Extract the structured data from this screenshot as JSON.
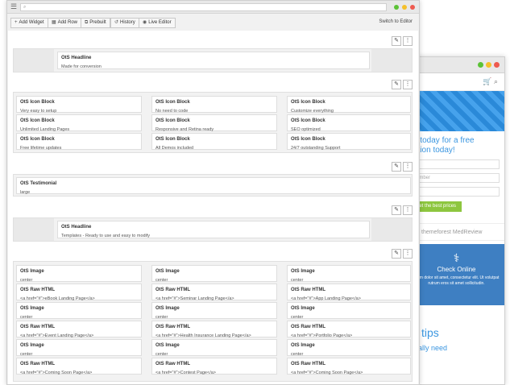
{
  "toolbar": {
    "add_widget": "Add Widget",
    "add_row": "Add Row",
    "prebuilt": "Prebuilt",
    "history": "History",
    "live_editor": "Live Editor",
    "switch": "Switch to Editor"
  },
  "rows": {
    "r1": {
      "title": "OtS Headline",
      "desc": "Made for conversion"
    },
    "r2": {
      "col1": [
        {
          "title": "OtS Icon Block",
          "desc": "Very easy to setup"
        },
        {
          "title": "OtS Icon Block",
          "desc": "Unlimited Landing Pages"
        },
        {
          "title": "OtS Icon Block",
          "desc": "Free lifetime updates"
        }
      ],
      "col2": [
        {
          "title": "OtS Icon Block",
          "desc": "No need to code"
        },
        {
          "title": "OtS Icon Block",
          "desc": "Responsive and Retina ready"
        },
        {
          "title": "OtS Icon Block",
          "desc": "All Demos included"
        }
      ],
      "col3": [
        {
          "title": "OtS Icon Block",
          "desc": "Customize everything"
        },
        {
          "title": "OtS Icon Block",
          "desc": "SEO optimized"
        },
        {
          "title": "OtS Icon Block",
          "desc": "24/7 outstanding Support"
        }
      ]
    },
    "r3": {
      "title": "OtS Testimonial",
      "desc": "large"
    },
    "r4": {
      "title": "OtS Headline",
      "desc": "Templates - Ready to use and easy to modify"
    },
    "r5": {
      "col1": [
        {
          "title": "OtS Image",
          "desc": "center"
        },
        {
          "title": "OtS Raw HTML",
          "desc": "<a href=\"#\">eBook Landing Page</a>"
        },
        {
          "title": "OtS Image",
          "desc": "center"
        },
        {
          "title": "OtS Raw HTML",
          "desc": "<a href=\"#\">Event Landing Page</a>"
        },
        {
          "title": "OtS Image",
          "desc": "center"
        },
        {
          "title": "OtS Raw HTML",
          "desc": "<a href=\"#\">Coming Soon Page</a>"
        }
      ],
      "col2": [
        {
          "title": "OtS Image",
          "desc": "center"
        },
        {
          "title": "OtS Raw HTML",
          "desc": "<a href=\"#\">Seminar Landing Page</a>"
        },
        {
          "title": "OtS Image",
          "desc": "center"
        },
        {
          "title": "OtS Raw HTML",
          "desc": "<a href=\"#\">Health Insurance Landing Page</a>"
        },
        {
          "title": "OtS Image",
          "desc": "center"
        },
        {
          "title": "OtS Raw HTML",
          "desc": "<a href=\"#\">Contest Page</a>"
        }
      ],
      "col3": [
        {
          "title": "OtS Image",
          "desc": "center"
        },
        {
          "title": "OtS Raw HTML",
          "desc": "<a href=\"#\">App Landing Page</a>"
        },
        {
          "title": "OtS Image",
          "desc": "center"
        },
        {
          "title": "OtS Raw HTML",
          "desc": "<a href=\"#\">Portfolio Page</a>"
        },
        {
          "title": "OtS Image",
          "desc": "center"
        },
        {
          "title": "OtS Raw HTML",
          "desc": "<a href=\"#\">Coming Soon Page</a>"
        }
      ]
    }
  },
  "preview": {
    "cta": "o today for a free\nation today!",
    "input_placeholder": "umber",
    "button": "get the best prices",
    "brands": "themeforest  MedReview",
    "check_title": "Check Online",
    "check_text": "orem dolor sit amet, consectetur elit. Ut volutpat rutrum eros sit amet sollicitudin.",
    "tips": "tips",
    "need": "ally need"
  },
  "colors": {
    "accent_blue": "#3b96e0",
    "green": "#8dc63f",
    "dot_green": "#5bc236",
    "dot_yellow": "#f5c02b",
    "dot_red": "#ee5a4f"
  }
}
